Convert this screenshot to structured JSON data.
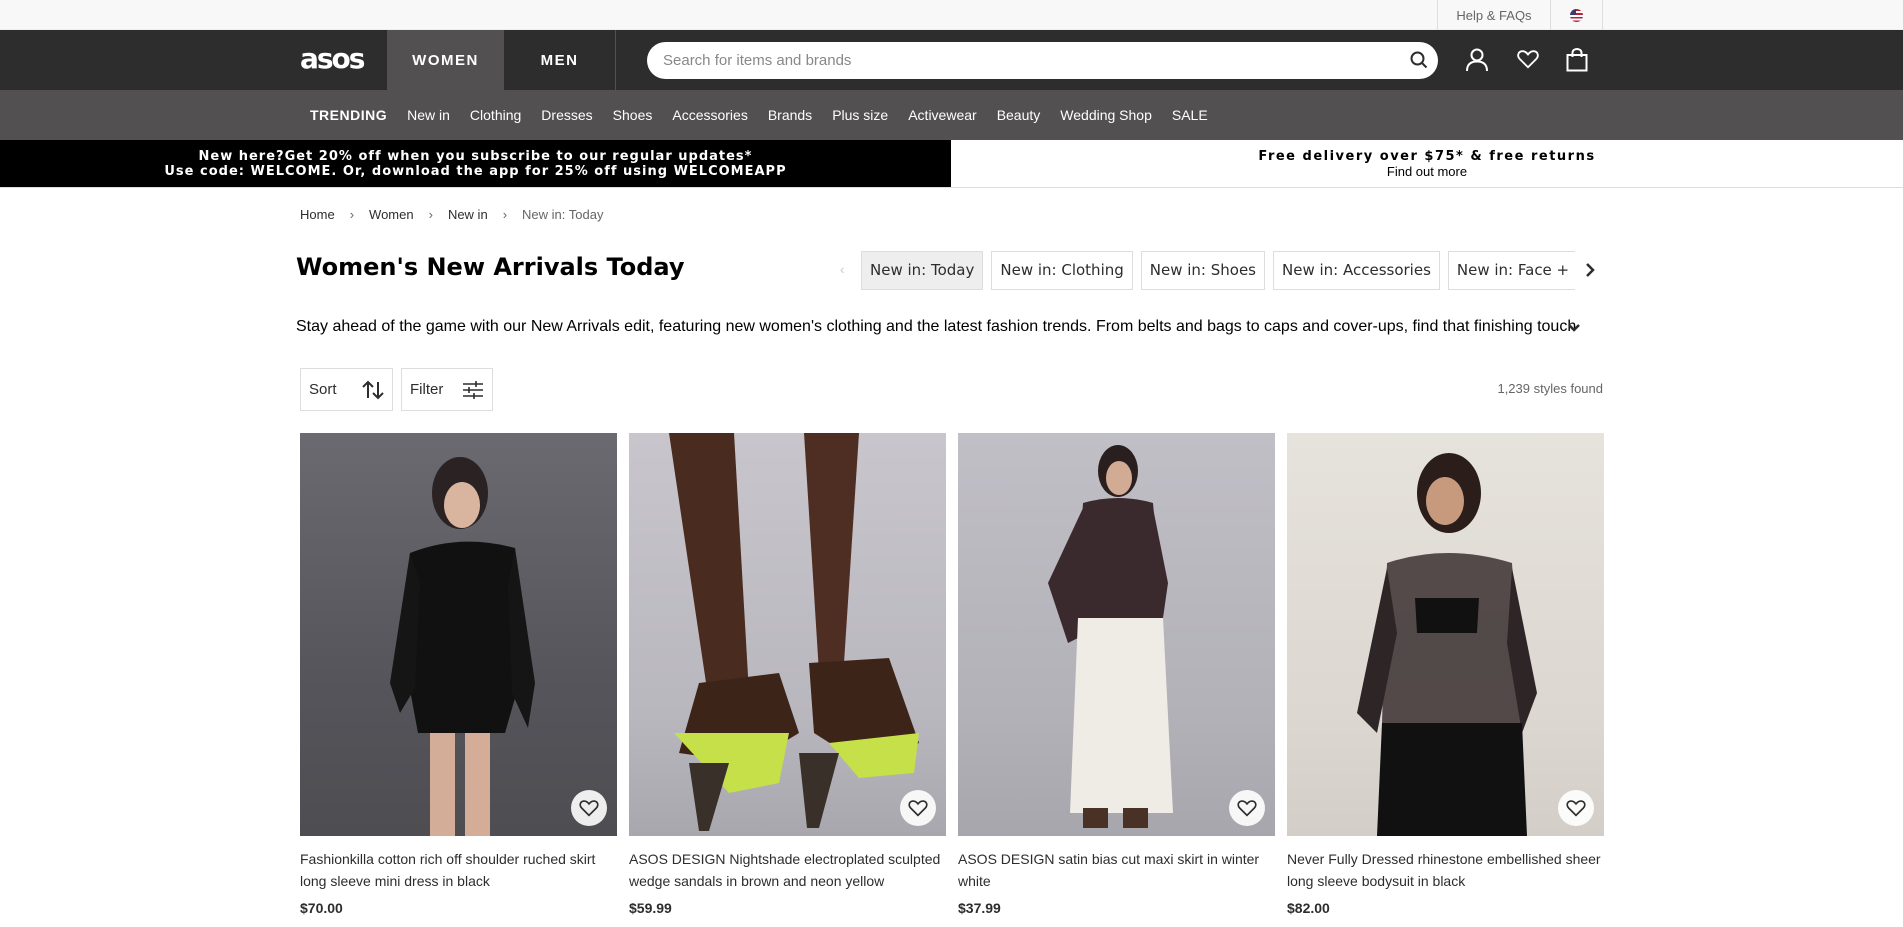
{
  "util": {
    "help": "Help & FAQs",
    "flag_icon": "us-flag-icon"
  },
  "header": {
    "logo": "asos",
    "tabs": [
      "WOMEN",
      "MEN"
    ],
    "search_placeholder": "Search for items and brands"
  },
  "catnav": {
    "items": [
      "TRENDING",
      "New in",
      "Clothing",
      "Dresses",
      "Shoes",
      "Accessories",
      "Brands",
      "Plus size",
      "Activewear",
      "Beauty",
      "Wedding Shop",
      "SALE"
    ]
  },
  "promo": {
    "left_line1": "New here?Get 20% off when you subscribe to our regular updates*",
    "left_line2": "Use code: WELCOME. Or, download the app for 25% off using WELCOMEAPP",
    "right_line1": "Free delivery over $75* & free returns",
    "right_line2": "Find out more"
  },
  "breadcrumb": [
    "Home",
    "Women",
    "New in",
    "New in: Today"
  ],
  "page": {
    "title": "Women's New Arrivals Today",
    "chips": [
      "New in: Today",
      "New in: Clothing",
      "New in: Shoes",
      "New in: Accessories",
      "New in: Face + Body"
    ],
    "description": "Stay ahead of the game with our New Arrivals edit, featuring new women's clothing and the latest fashion trends. From belts and bags to caps and cover-ups, find that finishing touch from all ...",
    "sort_label": "Sort",
    "filter_label": "Filter",
    "count": "1,239 styles found"
  },
  "products": [
    {
      "name": "Fashionkilla cotton rich off shoulder ruched skirt long sleeve mini dress in black",
      "price": "$70.00"
    },
    {
      "name": "ASOS DESIGN Nightshade electroplated sculpted wedge sandals in brown and neon yellow",
      "price": "$59.99"
    },
    {
      "name": "ASOS DESIGN satin bias cut maxi skirt in winter white",
      "price": "$37.99"
    },
    {
      "name": "Never Fully Dressed rhinestone embellished sheer long sleeve bodysuit in black",
      "price": "$82.00"
    }
  ]
}
